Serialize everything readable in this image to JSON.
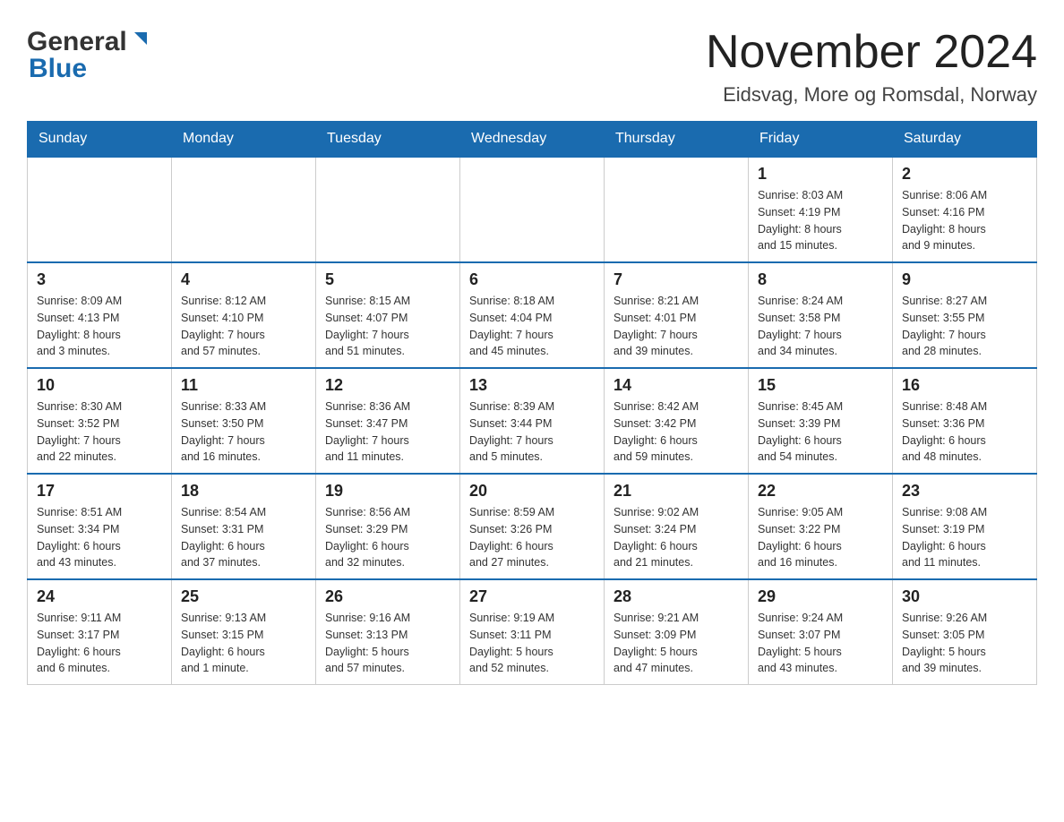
{
  "header": {
    "logo_general": "General",
    "logo_blue": "Blue",
    "main_title": "November 2024",
    "subtitle": "Eidsvag, More og Romsdal, Norway"
  },
  "weekdays": [
    "Sunday",
    "Monday",
    "Tuesday",
    "Wednesday",
    "Thursday",
    "Friday",
    "Saturday"
  ],
  "weeks": [
    {
      "days": [
        {
          "date": "",
          "info": ""
        },
        {
          "date": "",
          "info": ""
        },
        {
          "date": "",
          "info": ""
        },
        {
          "date": "",
          "info": ""
        },
        {
          "date": "",
          "info": ""
        },
        {
          "date": "1",
          "info": "Sunrise: 8:03 AM\nSunset: 4:19 PM\nDaylight: 8 hours\nand 15 minutes."
        },
        {
          "date": "2",
          "info": "Sunrise: 8:06 AM\nSunset: 4:16 PM\nDaylight: 8 hours\nand 9 minutes."
        }
      ]
    },
    {
      "days": [
        {
          "date": "3",
          "info": "Sunrise: 8:09 AM\nSunset: 4:13 PM\nDaylight: 8 hours\nand 3 minutes."
        },
        {
          "date": "4",
          "info": "Sunrise: 8:12 AM\nSunset: 4:10 PM\nDaylight: 7 hours\nand 57 minutes."
        },
        {
          "date": "5",
          "info": "Sunrise: 8:15 AM\nSunset: 4:07 PM\nDaylight: 7 hours\nand 51 minutes."
        },
        {
          "date": "6",
          "info": "Sunrise: 8:18 AM\nSunset: 4:04 PM\nDaylight: 7 hours\nand 45 minutes."
        },
        {
          "date": "7",
          "info": "Sunrise: 8:21 AM\nSunset: 4:01 PM\nDaylight: 7 hours\nand 39 minutes."
        },
        {
          "date": "8",
          "info": "Sunrise: 8:24 AM\nSunset: 3:58 PM\nDaylight: 7 hours\nand 34 minutes."
        },
        {
          "date": "9",
          "info": "Sunrise: 8:27 AM\nSunset: 3:55 PM\nDaylight: 7 hours\nand 28 minutes."
        }
      ]
    },
    {
      "days": [
        {
          "date": "10",
          "info": "Sunrise: 8:30 AM\nSunset: 3:52 PM\nDaylight: 7 hours\nand 22 minutes."
        },
        {
          "date": "11",
          "info": "Sunrise: 8:33 AM\nSunset: 3:50 PM\nDaylight: 7 hours\nand 16 minutes."
        },
        {
          "date": "12",
          "info": "Sunrise: 8:36 AM\nSunset: 3:47 PM\nDaylight: 7 hours\nand 11 minutes."
        },
        {
          "date": "13",
          "info": "Sunrise: 8:39 AM\nSunset: 3:44 PM\nDaylight: 7 hours\nand 5 minutes."
        },
        {
          "date": "14",
          "info": "Sunrise: 8:42 AM\nSunset: 3:42 PM\nDaylight: 6 hours\nand 59 minutes."
        },
        {
          "date": "15",
          "info": "Sunrise: 8:45 AM\nSunset: 3:39 PM\nDaylight: 6 hours\nand 54 minutes."
        },
        {
          "date": "16",
          "info": "Sunrise: 8:48 AM\nSunset: 3:36 PM\nDaylight: 6 hours\nand 48 minutes."
        }
      ]
    },
    {
      "days": [
        {
          "date": "17",
          "info": "Sunrise: 8:51 AM\nSunset: 3:34 PM\nDaylight: 6 hours\nand 43 minutes."
        },
        {
          "date": "18",
          "info": "Sunrise: 8:54 AM\nSunset: 3:31 PM\nDaylight: 6 hours\nand 37 minutes."
        },
        {
          "date": "19",
          "info": "Sunrise: 8:56 AM\nSunset: 3:29 PM\nDaylight: 6 hours\nand 32 minutes."
        },
        {
          "date": "20",
          "info": "Sunrise: 8:59 AM\nSunset: 3:26 PM\nDaylight: 6 hours\nand 27 minutes."
        },
        {
          "date": "21",
          "info": "Sunrise: 9:02 AM\nSunset: 3:24 PM\nDaylight: 6 hours\nand 21 minutes."
        },
        {
          "date": "22",
          "info": "Sunrise: 9:05 AM\nSunset: 3:22 PM\nDaylight: 6 hours\nand 16 minutes."
        },
        {
          "date": "23",
          "info": "Sunrise: 9:08 AM\nSunset: 3:19 PM\nDaylight: 6 hours\nand 11 minutes."
        }
      ]
    },
    {
      "days": [
        {
          "date": "24",
          "info": "Sunrise: 9:11 AM\nSunset: 3:17 PM\nDaylight: 6 hours\nand 6 minutes."
        },
        {
          "date": "25",
          "info": "Sunrise: 9:13 AM\nSunset: 3:15 PM\nDaylight: 6 hours\nand 1 minute."
        },
        {
          "date": "26",
          "info": "Sunrise: 9:16 AM\nSunset: 3:13 PM\nDaylight: 5 hours\nand 57 minutes."
        },
        {
          "date": "27",
          "info": "Sunrise: 9:19 AM\nSunset: 3:11 PM\nDaylight: 5 hours\nand 52 minutes."
        },
        {
          "date": "28",
          "info": "Sunrise: 9:21 AM\nSunset: 3:09 PM\nDaylight: 5 hours\nand 47 minutes."
        },
        {
          "date": "29",
          "info": "Sunrise: 9:24 AM\nSunset: 3:07 PM\nDaylight: 5 hours\nand 43 minutes."
        },
        {
          "date": "30",
          "info": "Sunrise: 9:26 AM\nSunset: 3:05 PM\nDaylight: 5 hours\nand 39 minutes."
        }
      ]
    }
  ]
}
